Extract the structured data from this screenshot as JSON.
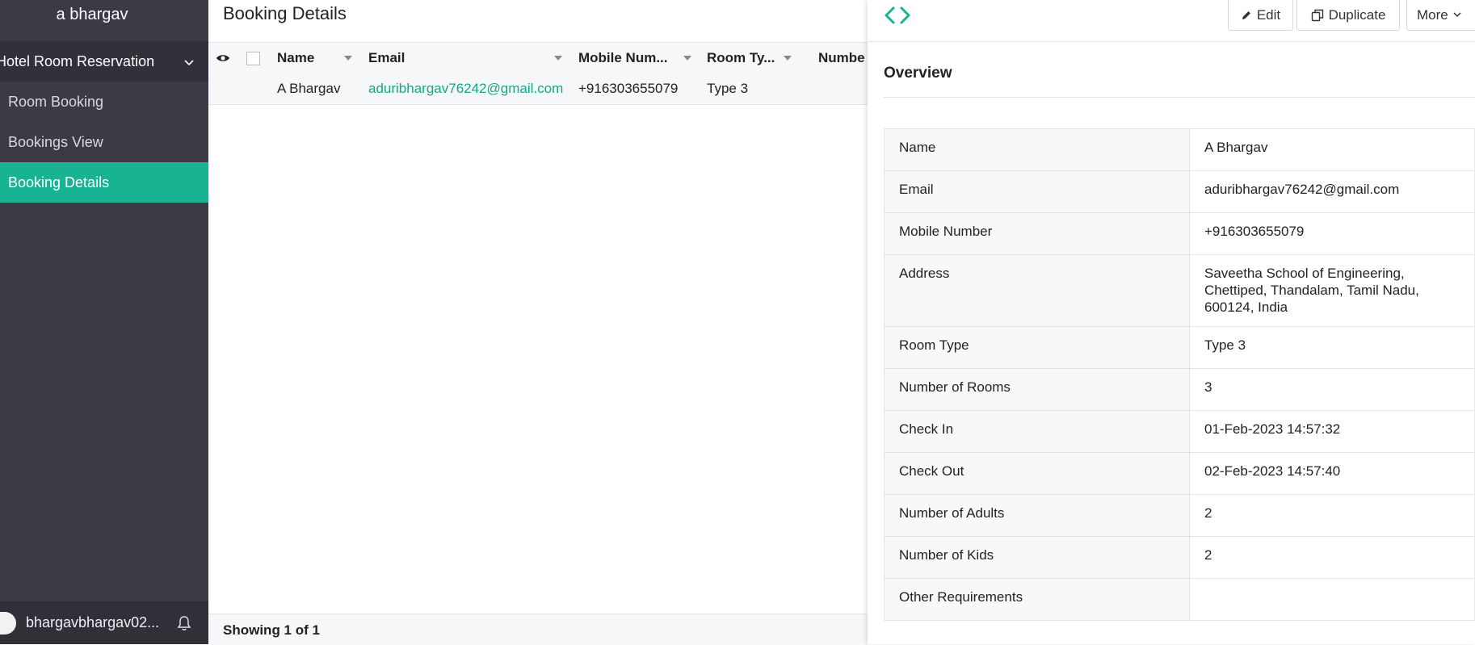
{
  "sidebar": {
    "app_title": "a bhargav",
    "section_label": "Hotel Room Reservation",
    "items": [
      {
        "label": "Room Booking"
      },
      {
        "label": "Bookings View"
      },
      {
        "label": "Booking Details"
      }
    ],
    "footer_user": "bhargavbhargav02..."
  },
  "main": {
    "title": "Booking Details",
    "columns": [
      "Name",
      "Email",
      "Mobile Num...",
      "Room Ty...",
      "Numbe"
    ],
    "row": {
      "name": "A Bhargav",
      "email": "aduribhargav76242@gmail.com",
      "mobile": "+916303655079",
      "room_type": "Type 3"
    },
    "status": "Showing 1 of 1"
  },
  "detail": {
    "buttons": {
      "edit": "Edit",
      "duplicate": "Duplicate",
      "more": "More"
    },
    "overview_title": "Overview",
    "fields": [
      {
        "label": "Name",
        "value": "A Bhargav"
      },
      {
        "label": "Email",
        "value": "aduribhargav76242@gmail.com"
      },
      {
        "label": "Mobile Number",
        "value": "+916303655079"
      },
      {
        "label": "Address",
        "value": "Saveetha School of Engineering, Chettiped, Thandalam, Tamil Nadu, 600124, India"
      },
      {
        "label": "Room Type",
        "value": "Type 3"
      },
      {
        "label": "Number of Rooms",
        "value": "3"
      },
      {
        "label": "Check In",
        "value": "01-Feb-2023 14:57:32"
      },
      {
        "label": "Check Out",
        "value": "02-Feb-2023 14:57:40"
      },
      {
        "label": "Number of Adults",
        "value": "2"
      },
      {
        "label": "Number of Kids",
        "value": "2"
      },
      {
        "label": "Other Requirements",
        "value": ""
      }
    ]
  },
  "colors": {
    "accent": "#18b393",
    "sidebar_bg": "#3a3b45",
    "link": "#13a886"
  },
  "icons": [
    "chevron-down-icon",
    "bell-icon",
    "eye-icon",
    "code-icon",
    "pencil-icon",
    "duplicate-icon"
  ]
}
